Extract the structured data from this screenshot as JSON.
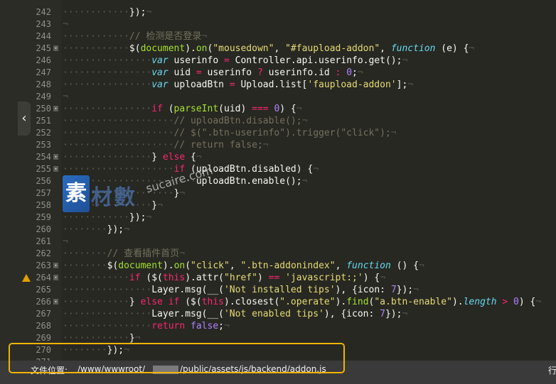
{
  "editor": {
    "collapse_icon": "chevron-left-icon",
    "lines": [
      {
        "num": "242",
        "fold": false,
        "warn": false,
        "indent": "            ",
        "tokens": [
          {
            "t": "});",
            "c": "t-p"
          }
        ]
      },
      {
        "num": "243",
        "fold": false,
        "warn": false,
        "indent": "",
        "tokens": []
      },
      {
        "num": "244",
        "fold": false,
        "warn": false,
        "indent": "            ",
        "tokens": [
          {
            "t": "// 检测是否登录",
            "c": "t-c"
          }
        ]
      },
      {
        "num": "245",
        "fold": true,
        "warn": false,
        "indent": "            ",
        "tokens": [
          {
            "t": "$(",
            "c": "t-p"
          },
          {
            "t": "document",
            "c": "t-f"
          },
          {
            "t": ").",
            "c": "t-p"
          },
          {
            "t": "on",
            "c": "t-f"
          },
          {
            "t": "(",
            "c": "t-p"
          },
          {
            "t": "\"mousedown\"",
            "c": "t-s"
          },
          {
            "t": ", ",
            "c": "t-p"
          },
          {
            "t": "\"#faupload-addon\"",
            "c": "t-s"
          },
          {
            "t": ", ",
            "c": "t-p"
          },
          {
            "t": "function",
            "c": "t-k"
          },
          {
            "t": " (e) {",
            "c": "t-p"
          }
        ]
      },
      {
        "num": "246",
        "fold": false,
        "warn": false,
        "indent": "                ",
        "tokens": [
          {
            "t": "var",
            "c": "t-k"
          },
          {
            "t": " userinfo ",
            "c": "t-p"
          },
          {
            "t": "=",
            "c": "t-o"
          },
          {
            "t": " Controller.api.userinfo.",
            "c": "t-p"
          },
          {
            "t": "get",
            "c": "t-p"
          },
          {
            "t": "();",
            "c": "t-p"
          }
        ]
      },
      {
        "num": "247",
        "fold": false,
        "warn": false,
        "indent": "                ",
        "tokens": [
          {
            "t": "var",
            "c": "t-k"
          },
          {
            "t": " uid ",
            "c": "t-p"
          },
          {
            "t": "=",
            "c": "t-o"
          },
          {
            "t": " userinfo ",
            "c": "t-p"
          },
          {
            "t": "?",
            "c": "t-o"
          },
          {
            "t": " userinfo.id ",
            "c": "t-p"
          },
          {
            "t": ":",
            "c": "t-o"
          },
          {
            "t": " ",
            "c": "t-p"
          },
          {
            "t": "0",
            "c": "t-n"
          },
          {
            "t": ";",
            "c": "t-p"
          }
        ]
      },
      {
        "num": "248",
        "fold": false,
        "warn": false,
        "indent": "                ",
        "tokens": [
          {
            "t": "var",
            "c": "t-k"
          },
          {
            "t": " uploadBtn ",
            "c": "t-p"
          },
          {
            "t": "=",
            "c": "t-o"
          },
          {
            "t": " Upload.list[",
            "c": "t-p"
          },
          {
            "t": "'faupload-addon'",
            "c": "t-s"
          },
          {
            "t": "];",
            "c": "t-p"
          }
        ]
      },
      {
        "num": "249",
        "fold": false,
        "warn": false,
        "indent": "",
        "tokens": []
      },
      {
        "num": "250",
        "fold": true,
        "warn": false,
        "indent": "                ",
        "tokens": [
          {
            "t": "if",
            "c": "t-kw"
          },
          {
            "t": " (",
            "c": "t-p"
          },
          {
            "t": "parseInt",
            "c": "t-f"
          },
          {
            "t": "(uid) ",
            "c": "t-p"
          },
          {
            "t": "===",
            "c": "t-o"
          },
          {
            "t": " ",
            "c": "t-p"
          },
          {
            "t": "0",
            "c": "t-n"
          },
          {
            "t": ") {",
            "c": "t-p"
          }
        ]
      },
      {
        "num": "251",
        "fold": false,
        "warn": false,
        "indent": "                    ",
        "tokens": [
          {
            "t": "// uploadBtn.disable();",
            "c": "t-c"
          }
        ]
      },
      {
        "num": "252",
        "fold": false,
        "warn": false,
        "indent": "                    ",
        "tokens": [
          {
            "t": "// $(\".btn-userinfo\").trigger(\"click\");",
            "c": "t-c"
          }
        ]
      },
      {
        "num": "253",
        "fold": false,
        "warn": false,
        "indent": "                    ",
        "tokens": [
          {
            "t": "// return false;",
            "c": "t-c"
          }
        ]
      },
      {
        "num": "254",
        "fold": true,
        "warn": false,
        "indent": "                ",
        "tokens": [
          {
            "t": "} ",
            "c": "t-p"
          },
          {
            "t": "else",
            "c": "t-kw"
          },
          {
            "t": " {",
            "c": "t-p"
          }
        ]
      },
      {
        "num": "255",
        "fold": true,
        "warn": false,
        "indent": "                    ",
        "tokens": [
          {
            "t": "if",
            "c": "t-kw"
          },
          {
            "t": " (uploadBtn.disabled) {",
            "c": "t-p"
          }
        ]
      },
      {
        "num": "256",
        "fold": false,
        "warn": false,
        "indent": "                        ",
        "tokens": [
          {
            "t": "uploadBtn.enable();",
            "c": "t-p"
          }
        ]
      },
      {
        "num": "257",
        "fold": false,
        "warn": false,
        "indent": "                    ",
        "tokens": [
          {
            "t": "}",
            "c": "t-p"
          }
        ]
      },
      {
        "num": "258",
        "fold": false,
        "warn": false,
        "indent": "                ",
        "tokens": [
          {
            "t": "}",
            "c": "t-p"
          }
        ]
      },
      {
        "num": "259",
        "fold": false,
        "warn": false,
        "indent": "            ",
        "tokens": [
          {
            "t": "});",
            "c": "t-p"
          }
        ]
      },
      {
        "num": "260",
        "fold": false,
        "warn": false,
        "indent": "        ",
        "tokens": [
          {
            "t": "});",
            "c": "t-p"
          }
        ]
      },
      {
        "num": "261",
        "fold": false,
        "warn": false,
        "indent": "",
        "tokens": []
      },
      {
        "num": "262",
        "fold": false,
        "warn": false,
        "indent": "        ",
        "tokens": [
          {
            "t": "// 查看插件首页",
            "c": "t-c"
          }
        ]
      },
      {
        "num": "263",
        "fold": true,
        "warn": false,
        "indent": "        ",
        "tokens": [
          {
            "t": "$(",
            "c": "t-p"
          },
          {
            "t": "document",
            "c": "t-f"
          },
          {
            "t": ").",
            "c": "t-p"
          },
          {
            "t": "on",
            "c": "t-f"
          },
          {
            "t": "(",
            "c": "t-p"
          },
          {
            "t": "\"click\"",
            "c": "t-s"
          },
          {
            "t": ", ",
            "c": "t-p"
          },
          {
            "t": "\".btn-addonindex\"",
            "c": "t-s"
          },
          {
            "t": ", ",
            "c": "t-p"
          },
          {
            "t": "function",
            "c": "t-k"
          },
          {
            "t": " () {",
            "c": "t-p"
          }
        ]
      },
      {
        "num": "264",
        "fold": true,
        "warn": true,
        "indent": "            ",
        "tokens": [
          {
            "t": "if",
            "c": "t-kw"
          },
          {
            "t": " ($(",
            "c": "t-p"
          },
          {
            "t": "this",
            "c": "t-kw"
          },
          {
            "t": ").",
            "c": "t-p"
          },
          {
            "t": "attr",
            "c": "t-p"
          },
          {
            "t": "(",
            "c": "t-p"
          },
          {
            "t": "\"href\"",
            "c": "t-s"
          },
          {
            "t": ") ",
            "c": "t-p"
          },
          {
            "t": "==",
            "c": "t-o"
          },
          {
            "t": " ",
            "c": "t-p"
          },
          {
            "t": "'javascript:;'",
            "c": "t-s"
          },
          {
            "t": ") {",
            "c": "t-p"
          }
        ]
      },
      {
        "num": "265",
        "fold": false,
        "warn": false,
        "indent": "                ",
        "tokens": [
          {
            "t": "Layer.msg(__(",
            "c": "t-p"
          },
          {
            "t": "'Not installed tips'",
            "c": "t-s"
          },
          {
            "t": "), {icon: ",
            "c": "t-p"
          },
          {
            "t": "7",
            "c": "t-n"
          },
          {
            "t": "});",
            "c": "t-p"
          }
        ]
      },
      {
        "num": "266",
        "fold": true,
        "warn": false,
        "indent": "            ",
        "tokens": [
          {
            "t": "} ",
            "c": "t-p"
          },
          {
            "t": "else if",
            "c": "t-kw"
          },
          {
            "t": " ($(",
            "c": "t-p"
          },
          {
            "t": "this",
            "c": "t-kw"
          },
          {
            "t": ").",
            "c": "t-p"
          },
          {
            "t": "closest",
            "c": "t-p"
          },
          {
            "t": "(",
            "c": "t-p"
          },
          {
            "t": "\".operate\"",
            "c": "t-s"
          },
          {
            "t": ").",
            "c": "t-p"
          },
          {
            "t": "find",
            "c": "t-f"
          },
          {
            "t": "(",
            "c": "t-p"
          },
          {
            "t": "\"a.btn-enable\"",
            "c": "t-s"
          },
          {
            "t": ").",
            "c": "t-p"
          },
          {
            "t": "length",
            "c": "t-k"
          },
          {
            "t": " ",
            "c": "t-p"
          },
          {
            "t": ">",
            "c": "t-o"
          },
          {
            "t": " ",
            "c": "t-p"
          },
          {
            "t": "0",
            "c": "t-n"
          },
          {
            "t": ") {",
            "c": "t-p"
          }
        ]
      },
      {
        "num": "267",
        "fold": false,
        "warn": false,
        "indent": "                ",
        "tokens": [
          {
            "t": "Layer.msg(__(",
            "c": "t-p"
          },
          {
            "t": "'Not enabled tips'",
            "c": "t-s"
          },
          {
            "t": "), {icon: ",
            "c": "t-p"
          },
          {
            "t": "7",
            "c": "t-n"
          },
          {
            "t": "});",
            "c": "t-p"
          }
        ]
      },
      {
        "num": "268",
        "fold": false,
        "warn": false,
        "indent": "                ",
        "tokens": [
          {
            "t": "return",
            "c": "t-kw"
          },
          {
            "t": " ",
            "c": "t-p"
          },
          {
            "t": "false",
            "c": "t-n"
          },
          {
            "t": ";",
            "c": "t-p"
          }
        ]
      },
      {
        "num": "269",
        "fold": false,
        "warn": false,
        "indent": "            ",
        "tokens": [
          {
            "t": "}",
            "c": "t-p"
          }
        ]
      },
      {
        "num": "270",
        "fold": false,
        "warn": false,
        "indent": "        ",
        "tokens": [
          {
            "t": "});",
            "c": "t-p"
          }
        ]
      },
      {
        "num": "271",
        "fold": false,
        "warn": false,
        "indent": "",
        "tokens": []
      }
    ]
  },
  "watermark": {
    "logo_char": "素",
    "chars": "材數",
    "url": "sucaire.com"
  },
  "statusbar": {
    "label": "文件位置:",
    "path_prefix": "/www/wwwroot/",
    "path_suffix": "/public/assets/js/backend/addon.js",
    "right_text": "行"
  },
  "colors": {
    "background": "#272822",
    "highlight_border": "#f0b400"
  }
}
